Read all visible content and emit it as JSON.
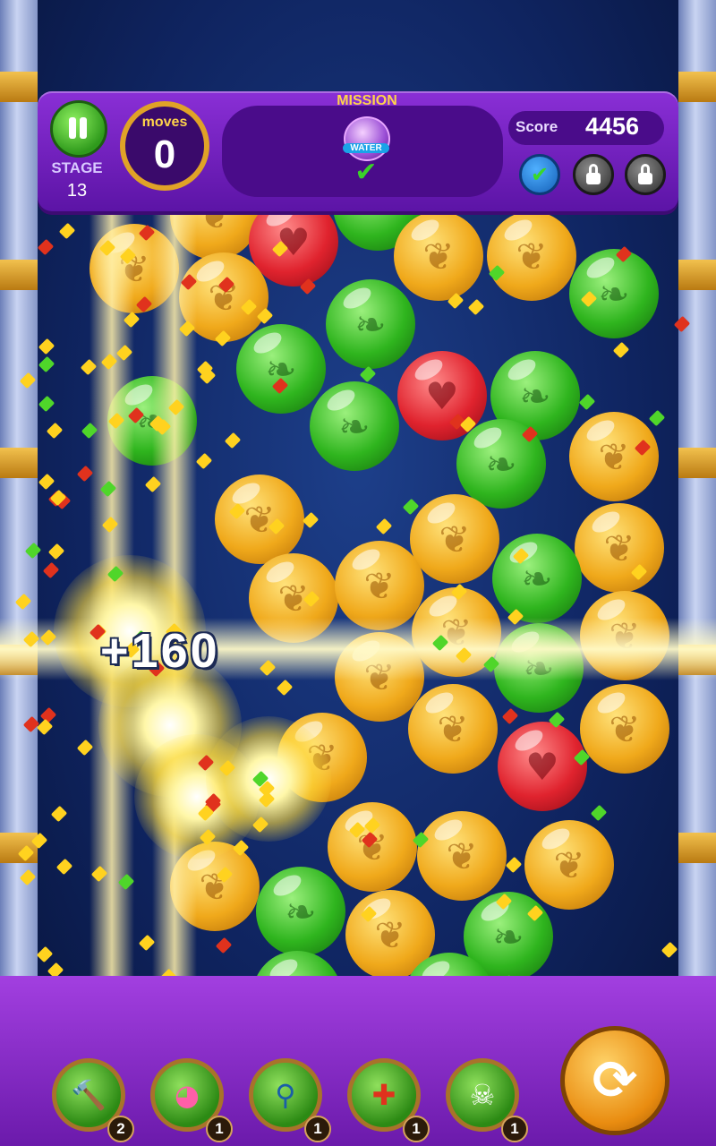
{
  "hud": {
    "stage_label": "STAGE",
    "stage_number": "13",
    "moves_label": "moves",
    "moves_value": "0",
    "mission_title": "MISSION",
    "mission_item_label": "WATER",
    "mission_check": "✔",
    "score_label": "Score",
    "score_value": "4456",
    "goals": [
      {
        "state": "complete",
        "icon": "check-icon",
        "glyph": "✔"
      },
      {
        "state": "locked",
        "icon": "lock-icon"
      },
      {
        "state": "locked",
        "icon": "lock-icon"
      }
    ]
  },
  "effects": {
    "score_popup": "+160"
  },
  "bubbles": {
    "symbols": {
      "yellow": "butterfly-icon",
      "green": "leaf-icon",
      "red": "heart-icon"
    },
    "glyphs": {
      "yellow": "❦",
      "green": "❧",
      "red": "♥"
    }
  },
  "boosters": [
    {
      "name": "hammer",
      "icon": "hammer-icon",
      "glyph": "🔨",
      "count": "2"
    },
    {
      "name": "rainbow-ball",
      "icon": "rainbow-ball-icon",
      "glyph": "◕",
      "count": "1"
    },
    {
      "name": "magnifier",
      "icon": "magnifier-icon",
      "glyph": "⚲",
      "count": "1"
    },
    {
      "name": "cross-blast",
      "icon": "cross-blast-icon",
      "glyph": "✚",
      "count": "1"
    },
    {
      "name": "skull-bomb",
      "icon": "skull-bomb-icon",
      "glyph": "☠",
      "count": "1"
    }
  ],
  "swap_button": {
    "icon": "swap-icon",
    "glyph": "⟳"
  },
  "colors": {
    "hud_purple": "#7a22c9",
    "gold": "#e0a227",
    "bubble_yellow": "#f0a91b",
    "bubble_green": "#2fb51e",
    "bubble_red": "#e0232e"
  }
}
